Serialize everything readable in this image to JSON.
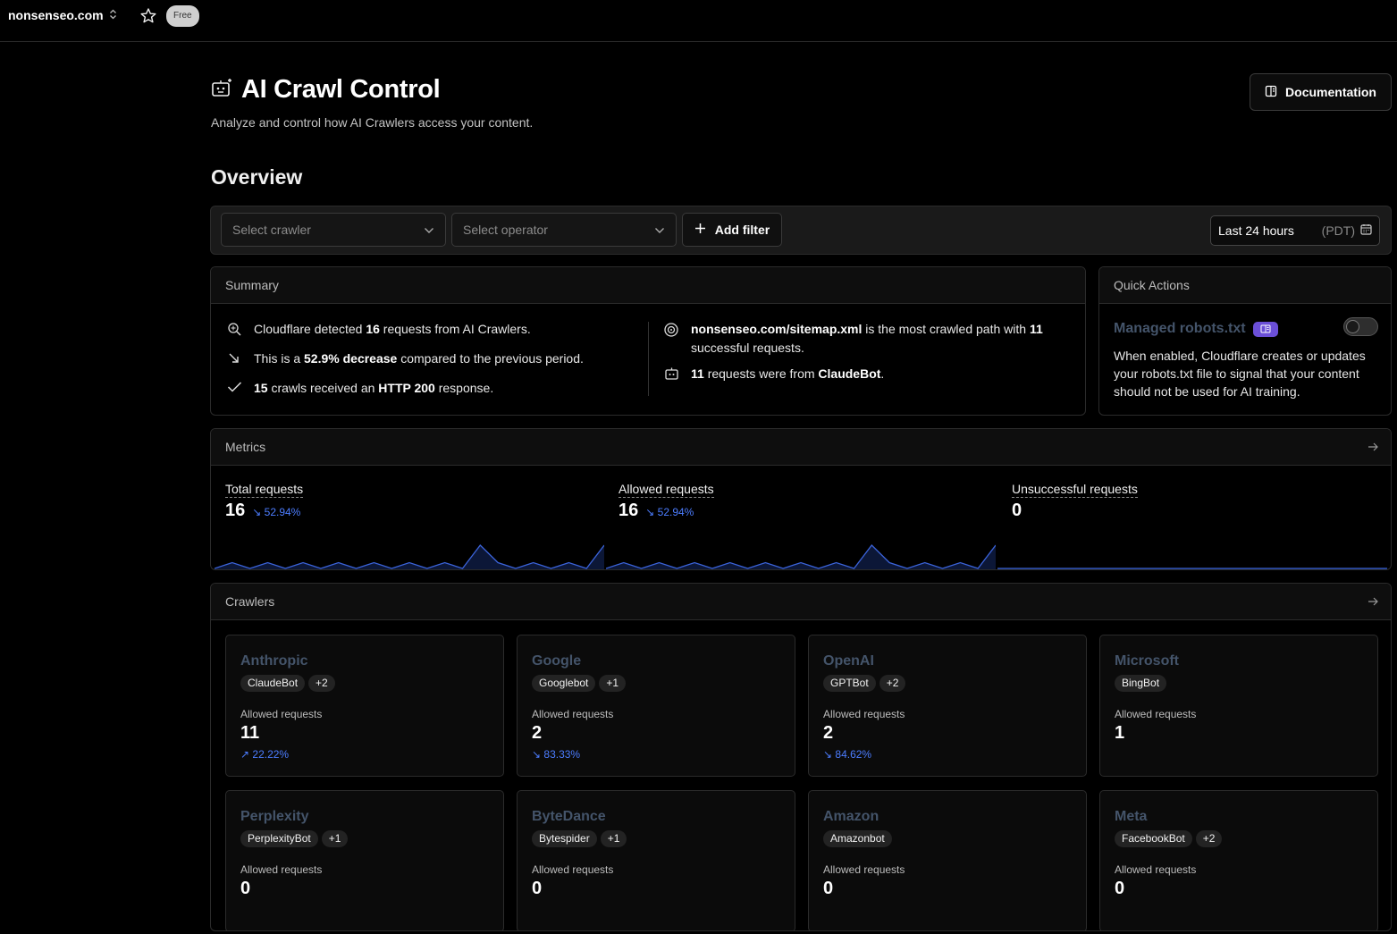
{
  "topbar": {
    "zone": "nonsenseo.com",
    "plan": "Free"
  },
  "header": {
    "title": "AI Crawl Control",
    "subtitle": "Analyze and control how AI Crawlers access your content.",
    "doc_button": "Documentation"
  },
  "overview_title": "Overview",
  "filters": {
    "crawler_placeholder": "Select crawler",
    "operator_placeholder": "Select operator",
    "add_filter": "Add filter",
    "time_range": "Last 24 hours",
    "timezone": "(PDT)"
  },
  "summary": {
    "title": "Summary",
    "l1": {
      "a": "Cloudflare detected ",
      "b": "16",
      "c": " requests from AI Crawlers."
    },
    "l2": {
      "a": "This is a ",
      "b": "52.9% decrease",
      "c": " compared to the previous period."
    },
    "l3": {
      "a": "15",
      "b": " crawls received an ",
      "c": "HTTP 200",
      "d": " response."
    },
    "r1": {
      "a": "nonsenseo.com/sitemap.xml",
      "b": " is the most crawled path with ",
      "c": "11",
      "d": " successful requests."
    },
    "r2": {
      "a": "11",
      "b": " requests were from ",
      "c": "ClaudeBot",
      "d": "."
    }
  },
  "quick_actions": {
    "title": "Quick Actions",
    "item_title": "Managed robots.txt",
    "enabled": false,
    "description": "When enabled, Cloudflare creates or updates your robots.txt file to signal that your content should not be used for AI training."
  },
  "metrics": {
    "title": "Metrics",
    "items": [
      {
        "label": "Total requests",
        "value": "16",
        "change": "52.94%",
        "trend": "down",
        "series": [
          0,
          1,
          0,
          1,
          0,
          1,
          0,
          1,
          0,
          1,
          0,
          1,
          0,
          1,
          0,
          4,
          1,
          0,
          1,
          0,
          1,
          0,
          4
        ]
      },
      {
        "label": "Allowed requests",
        "value": "16",
        "change": "52.94%",
        "trend": "down",
        "series": [
          0,
          1,
          0,
          1,
          0,
          1,
          0,
          1,
          0,
          1,
          0,
          1,
          0,
          1,
          0,
          4,
          1,
          0,
          1,
          0,
          1,
          0,
          4
        ]
      },
      {
        "label": "Unsuccessful requests",
        "value": "0",
        "change": "",
        "trend": "none",
        "series": [
          0,
          0,
          0,
          0,
          0,
          0,
          0,
          0,
          0,
          0,
          0,
          0,
          0,
          0,
          0,
          0,
          0,
          0,
          0,
          0,
          0,
          0,
          0
        ]
      }
    ]
  },
  "crawlers": {
    "title": "Crawlers",
    "cards": [
      {
        "operator": "Anthropic",
        "bot": "ClaudeBot",
        "more": "+2",
        "label": "Allowed requests",
        "value": "11",
        "change": "22.22%",
        "trend": "up"
      },
      {
        "operator": "Google",
        "bot": "Googlebot",
        "more": "+1",
        "label": "Allowed requests",
        "value": "2",
        "change": "83.33%",
        "trend": "down"
      },
      {
        "operator": "OpenAI",
        "bot": "GPTBot",
        "more": "+2",
        "label": "Allowed requests",
        "value": "2",
        "change": "84.62%",
        "trend": "down"
      },
      {
        "operator": "Microsoft",
        "bot": "BingBot",
        "more": "",
        "label": "Allowed requests",
        "value": "1",
        "change": "",
        "trend": "none"
      },
      {
        "operator": "Perplexity",
        "bot": "PerplexityBot",
        "more": "+1",
        "label": "Allowed requests",
        "value": "0",
        "change": "",
        "trend": "none"
      },
      {
        "operator": "ByteDance",
        "bot": "Bytespider",
        "more": "+1",
        "label": "Allowed requests",
        "value": "0",
        "change": "",
        "trend": "none"
      },
      {
        "operator": "Amazon",
        "bot": "Amazonbot",
        "more": "",
        "label": "Allowed requests",
        "value": "0",
        "change": "",
        "trend": "none"
      },
      {
        "operator": "Meta",
        "bot": "FacebookBot",
        "more": "+2",
        "label": "Allowed requests",
        "value": "0",
        "change": "",
        "trend": "none"
      }
    ]
  },
  "colors": {
    "accent_blue": "#4c7dff",
    "operator_name": "#44546a",
    "badge_purple": "#6b4fd8",
    "spark_line": "#3b63d9"
  },
  "icons": [
    "chevron-updown-icon",
    "star-icon",
    "robot-icon",
    "book-icon",
    "chevron-down-icon",
    "plus-icon",
    "calendar-icon",
    "search-sparkle-icon",
    "trend-down-icon",
    "check-icon",
    "target-icon",
    "bot-icon",
    "arrow-right-icon",
    "trend-up-icon"
  ]
}
